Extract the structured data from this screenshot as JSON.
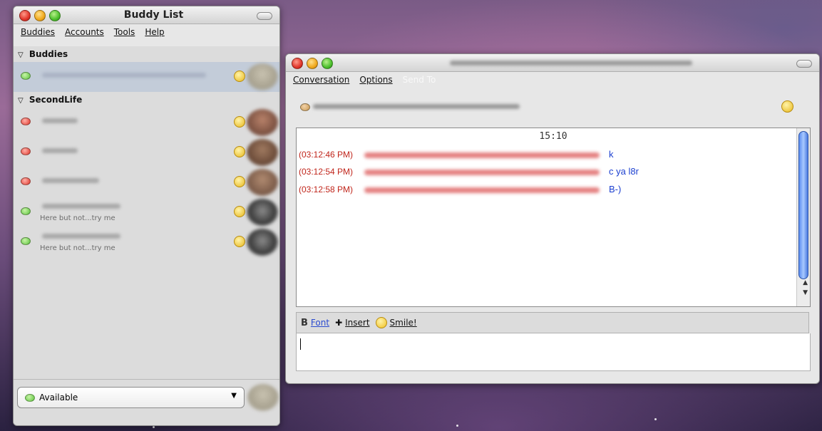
{
  "buddy_list": {
    "title": "Buddy List",
    "menu": [
      "Buddies",
      "Accounts",
      "Tools",
      "Help"
    ],
    "groups": [
      {
        "name": "Buddies",
        "buddies": [
          {
            "status": "green",
            "status_text": "",
            "selected": true
          }
        ]
      },
      {
        "name": "SecondLife",
        "buddies": [
          {
            "status": "red",
            "status_text": ""
          },
          {
            "status": "red",
            "status_text": ""
          },
          {
            "status": "red",
            "status_text": ""
          },
          {
            "status": "green",
            "status_text": "Here but not...try me"
          },
          {
            "status": "green",
            "status_text": "Here but not...try me"
          }
        ]
      }
    ],
    "status_selector": {
      "value": "Available"
    }
  },
  "conversation": {
    "menu": [
      "Conversation",
      "Options",
      "Send To"
    ],
    "time_header": "15:10",
    "messages": [
      {
        "time": "(03:12:46 PM)",
        "text": "k"
      },
      {
        "time": "(03:12:54 PM)",
        "text": "c ya l8r"
      },
      {
        "time": "(03:12:58 PM)",
        "text": "B-)"
      }
    ],
    "format_toolbar": {
      "font": "Font",
      "insert": "Insert",
      "smile": "Smile!"
    },
    "input_value": ""
  },
  "colors": {
    "timestamp": "#c0241a",
    "message_text": "#1b3fd0",
    "selected_row": "#c3ccd9"
  }
}
